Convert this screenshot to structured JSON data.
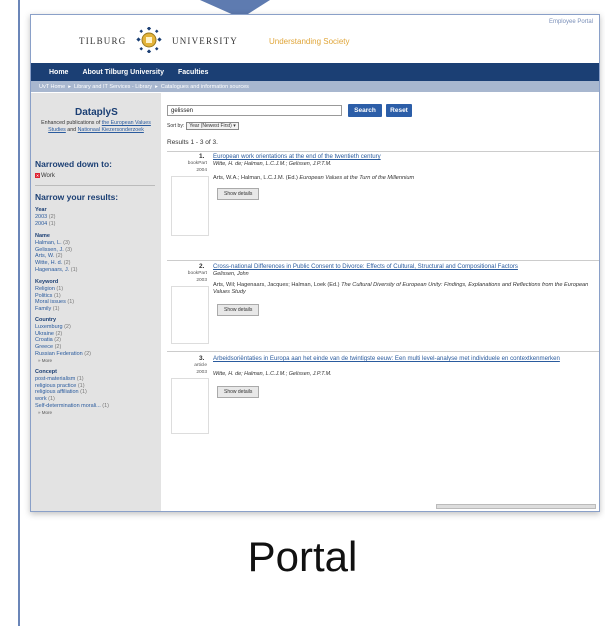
{
  "header": {
    "logo_left": "TILBURG",
    "logo_right": "UNIVERSITY",
    "tagline": "Understanding Society",
    "employee_portal": "Employee Portal"
  },
  "nav": {
    "items": [
      "Home",
      "About Tilburg University",
      "Faculties"
    ]
  },
  "breadcrumb": [
    "UvT Home",
    "▸",
    "Library and IT Services - Library",
    "▸",
    "Catalogues and information sources"
  ],
  "sidebar": {
    "title": "DataplуS",
    "desc_pre": "Enhanced publications of ",
    "desc_link1": "the European Values Studies",
    "desc_mid": " and ",
    "desc_link2": "Nationaal Kiezersonderzoek",
    "narrowed_title": "Narrowed down to:",
    "narrowed_item": "Work",
    "narrow_title": "Narrow your results:",
    "facets": [
      {
        "head": "Year",
        "items": [
          [
            "2003",
            "(2)"
          ],
          [
            "2004",
            "(1)"
          ]
        ]
      },
      {
        "head": "Name",
        "items": [
          [
            "Halman, L.",
            "(3)"
          ],
          [
            "Gelissen, J.",
            "(3)"
          ],
          [
            "Arts, W.",
            "(2)"
          ],
          [
            "Witte, H. d.",
            "(2)"
          ],
          [
            "Hagenaars, J.",
            "(1)"
          ]
        ]
      },
      {
        "head": "Keyword",
        "items": [
          [
            "Religion",
            "(1)"
          ],
          [
            "Politics",
            "(1)"
          ],
          [
            "Moral issues",
            "(1)"
          ],
          [
            "Family",
            "(1)"
          ]
        ]
      },
      {
        "head": "Country",
        "items": [
          [
            "Luxemburg",
            "(2)"
          ],
          [
            "Ukraine",
            "(2)"
          ],
          [
            "Croatia",
            "(2)"
          ],
          [
            "Greece",
            "(2)"
          ],
          [
            "Russian Federation",
            "(2)"
          ]
        ],
        "more": "» More"
      },
      {
        "head": "Concept",
        "items": [
          [
            "post-materialism",
            "(1)"
          ],
          [
            "religious practice",
            "(1)"
          ],
          [
            "religious affiliation",
            "(1)"
          ],
          [
            "work",
            "(1)"
          ],
          [
            "Self-determination morali...",
            "(1)"
          ]
        ],
        "more": "» More"
      }
    ]
  },
  "search": {
    "value": "gelissen",
    "search_label": "Search",
    "reset_label": "Reset",
    "sort_label": "Sort by:",
    "sort_value": "Year (Newest First)",
    "results_text": "Results 1 - 3 of 3."
  },
  "results": [
    {
      "num": "1.",
      "type": "bookPart",
      "year": "2004",
      "title": "European work orientations at the end of the twentieth century",
      "authors": "Witte, H. de; Halman, L.C.J.M.; Gelissen, J.P.T.M.",
      "pub_plain": "Arts, W.A.; Halman, L.C.J.M. (Ed.) ",
      "pub_italic": "European Values at the Turn of the Millennium",
      "details": "Show details"
    },
    {
      "num": "2.",
      "type": "bookPart",
      "year": "2003",
      "title": "Cross-national Differences in Public Consent to Divorce: Effects of Cultural, Structural and Compositional Factors",
      "authors": "Gelissen, John",
      "pub_plain": "Arts, Wil; Hagenaars, Jacques; Halman, Loek (Ed.) ",
      "pub_italic": "The Cultural Diversity of European Unity: Findings, Explanations and Reflections from the European Values Study",
      "details": "Show details"
    },
    {
      "num": "3.",
      "type": "article",
      "year": "2003",
      "title": "Arbeidsoriëntaties in Europa aan het einde van de twintigste eeuw: Een multi level-analyse met individuele en contextkenmerken",
      "authors": "Witte, H. de; Halman, L.C.J.M.; Gelissen, J.P.T.M.",
      "pub_plain": "",
      "pub_italic": "",
      "details": "Show details"
    }
  ],
  "caption": "Portal"
}
